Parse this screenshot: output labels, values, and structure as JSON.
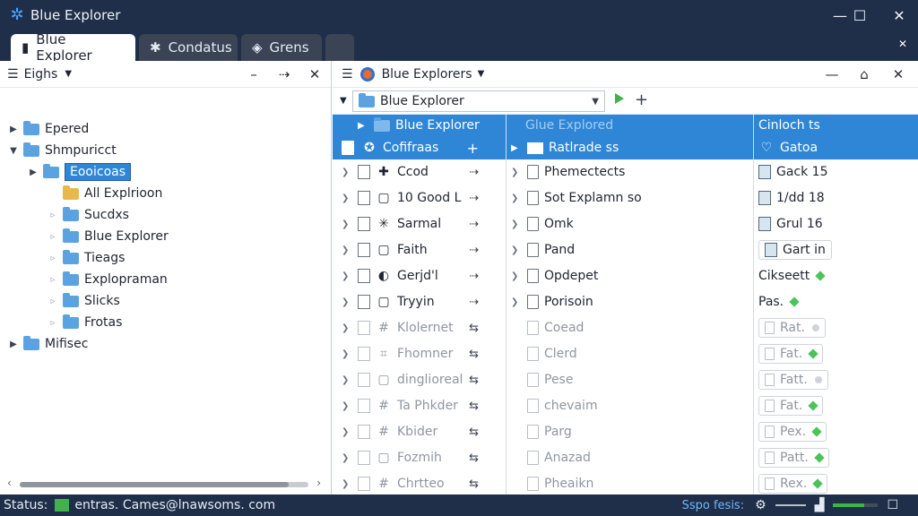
{
  "window": {
    "title": "Blue Explorer",
    "min": "—",
    "max": "☐",
    "close": "✕"
  },
  "tabs": [
    {
      "label": "Blue Explorer",
      "icon": "file-icon",
      "active": true
    },
    {
      "label": "Condatus",
      "icon": "gear-icon",
      "active": false
    },
    {
      "label": "Grens",
      "icon": "tag-icon",
      "active": false
    }
  ],
  "left_pane": {
    "title": "Eighs",
    "tree": [
      {
        "label": "Epered",
        "indent": 0,
        "arrow": "▶",
        "folder": "blue"
      },
      {
        "label": "Shmpuricct",
        "indent": 0,
        "arrow": "▼",
        "folder": "blue"
      },
      {
        "label": "Eooicoas",
        "indent": 1,
        "arrow": "▶",
        "folder": "blue",
        "selected": true
      },
      {
        "label": "All Explrioon",
        "indent": 2,
        "arrow": "",
        "folder": "yellow"
      },
      {
        "label": "Sucdxs",
        "indent": 2,
        "arrow": "▹",
        "folder": "blue"
      },
      {
        "label": "Blue Explorer",
        "indent": 2,
        "arrow": "▹",
        "folder": "blue"
      },
      {
        "label": "Tieags",
        "indent": 2,
        "arrow": "▹",
        "folder": "blue"
      },
      {
        "label": "Explopraman",
        "indent": 2,
        "arrow": "▹",
        "folder": "blue"
      },
      {
        "label": "Slicks",
        "indent": 2,
        "arrow": "▹",
        "folder": "blue"
      },
      {
        "label": "Frotas",
        "indent": 2,
        "arrow": "▹",
        "folder": "blue"
      },
      {
        "label": "Mifisec",
        "indent": 0,
        "arrow": "▶",
        "folder": "blue"
      }
    ]
  },
  "right_pane": {
    "title": "Blue Explorers",
    "address": "Blue Explorer",
    "columns": [
      "Blue Explorer",
      "Glue Explored",
      "Cinloch ts"
    ],
    "selected_row": {
      "c1": "Cofifraas",
      "c2": "Ratlrade ss",
      "c3": "Gatoa"
    },
    "rows": [
      {
        "c1": "Ccod",
        "c2": "Phemectects",
        "c3": "Gack 15",
        "faded": false
      },
      {
        "c1": "10 Good L",
        "c2": "Sot Explamn so",
        "c3": "1/dd 18",
        "faded": false
      },
      {
        "c1": "Sarmal",
        "c2": "Omk",
        "c3": "Grul 16",
        "faded": false
      },
      {
        "c1": "Faith",
        "c2": "Pand",
        "c3": "Gart in",
        "faded": false
      },
      {
        "c1": "Gerjd'l",
        "c2": "Opdepet",
        "c3": "Cikseett",
        "faded": false
      },
      {
        "c1": "Tryyin",
        "c2": "Porisoin",
        "c3": "Pas.",
        "faded": false
      },
      {
        "c1": "Klolernet",
        "c2": "Coead",
        "c3": "Rat.",
        "faded": true
      },
      {
        "c1": "Fhomner",
        "c2": "Clerd",
        "c3": "Fat.",
        "faded": true
      },
      {
        "c1": "dinglioreal",
        "c2": "Pese",
        "c3": "Fatt.",
        "faded": true
      },
      {
        "c1": "Ta Phkder",
        "c2": "chevaim",
        "c3": "Fat.",
        "faded": true
      },
      {
        "c1": "Kbider",
        "c2": "Parg",
        "c3": "Pex.",
        "faded": true
      },
      {
        "c1": "Fozmih",
        "c2": "Anazad",
        "c3": "Patt.",
        "faded": true
      },
      {
        "c1": "Chrtteo",
        "c2": "Pheaikn",
        "c3": "Rex.",
        "faded": true
      }
    ]
  },
  "statusbar": {
    "label": "Status:",
    "email": "entras. Cames@lnawsoms. com",
    "right_label": "Sspo fesis:",
    "progress": 0.7
  }
}
